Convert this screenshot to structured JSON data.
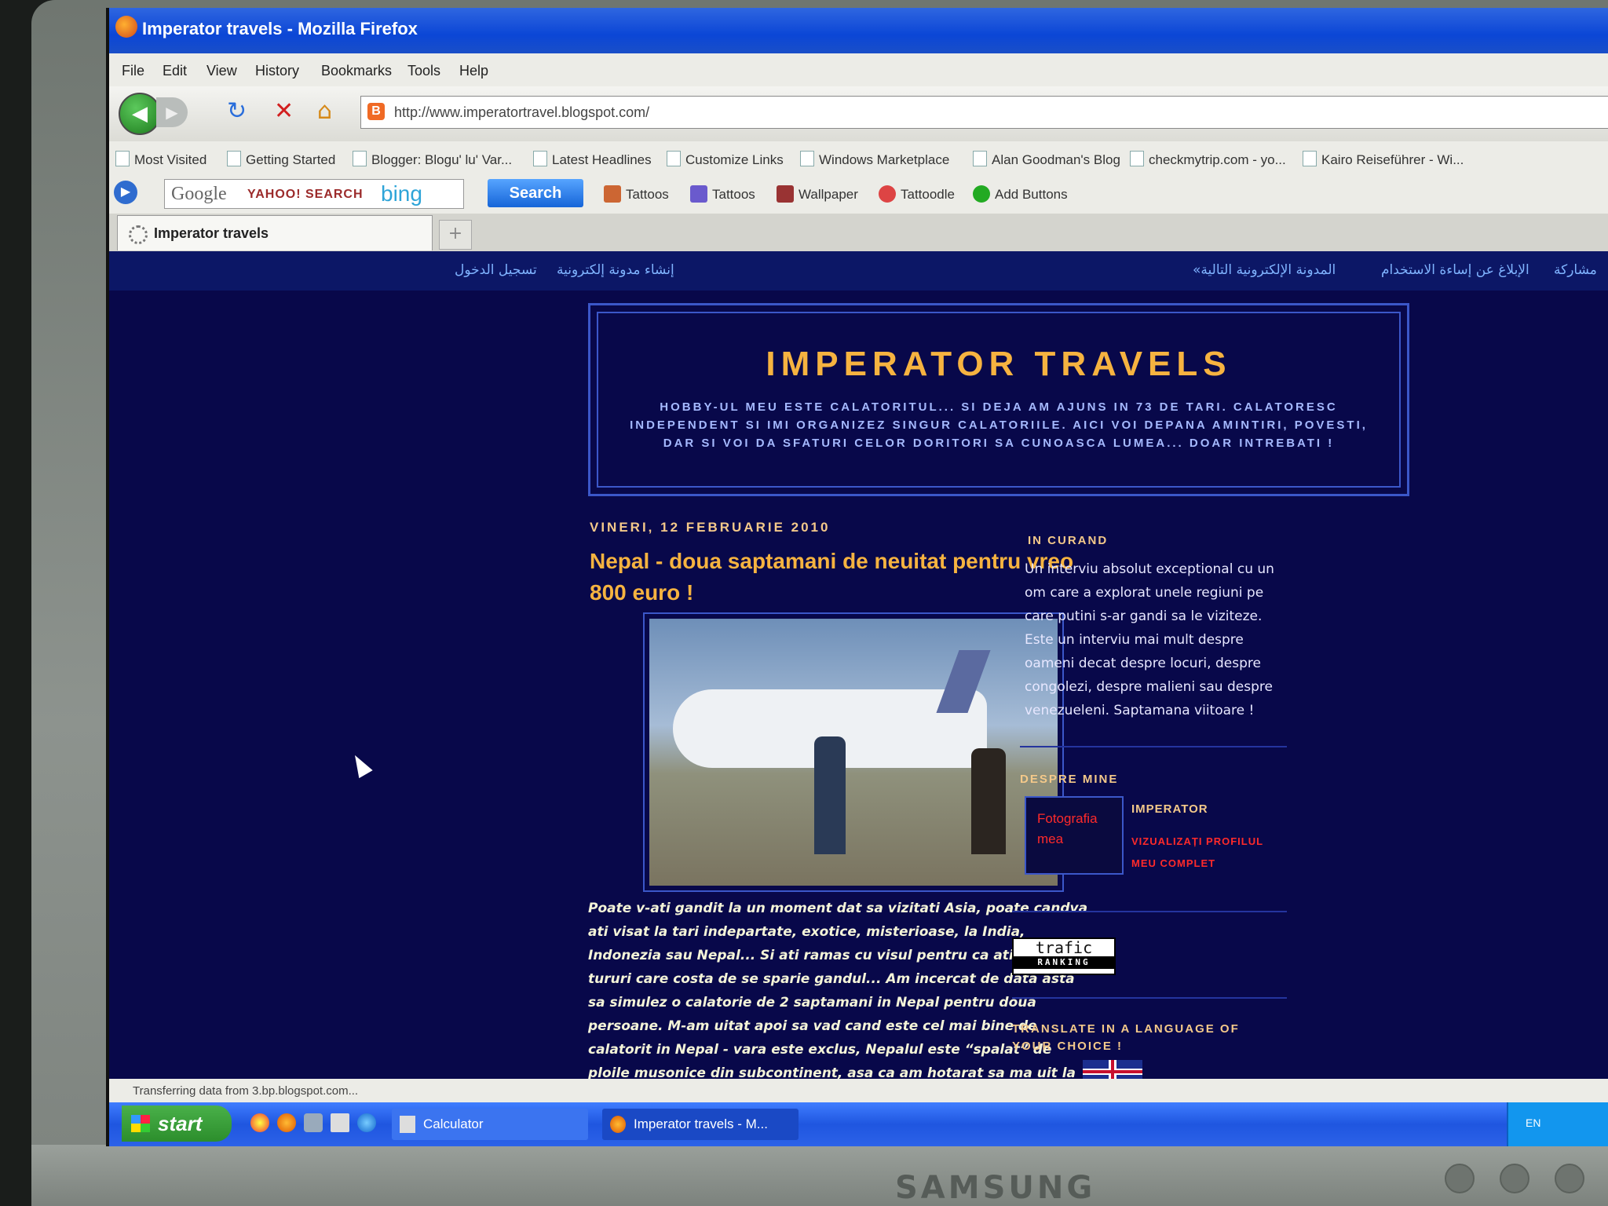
{
  "window": {
    "title": "Imperator travels - Mozilla Firefox"
  },
  "menu": [
    "File",
    "Edit",
    "View",
    "History",
    "Bookmarks",
    "Tools",
    "Help"
  ],
  "address": {
    "url": "http://www.imperatortravel.blogspot.com/"
  },
  "bookmarks": [
    "Most Visited",
    "Getting Started",
    "Blogger: Blogu' lu' Var...",
    "Latest Headlines",
    "Customize Links",
    "Windows Marketplace",
    "Alan Goodman's Blog",
    "checkmytrip.com - yo...",
    "Kairo Reiseführer - Wi..."
  ],
  "search_toolbar": {
    "google": "Google",
    "yahoo": "YAHOO! SEARCH",
    "bing": "bing",
    "search_button": "Search",
    "buttons": [
      "Tattoos",
      "Tattoos",
      "Wallpaper",
      "Tattoodle",
      "Add Buttons"
    ]
  },
  "tab": {
    "label": "Imperator travels"
  },
  "blogger_bar": {
    "left_links": [
      "إنشاء مدونة إلكترونية",
      "تسجيل الدخول"
    ],
    "right_links": [
      "المدونة الإلكترونية التالية»",
      "الإبلاغ عن إساءة الاستخدام",
      "مشاركة"
    ]
  },
  "blog": {
    "title": "IMPERATOR TRAVELS",
    "description": "HOBBY-UL MEU ESTE CALATORITUL... SI DEJA AM AJUNS IN 73 DE TARI. CALATORESC INDEPENDENT SI IMI ORGANIZEZ SINGUR CALATORIILE. AICI VOI DEPANA AMINTIRI, POVESTI, DAR SI VOI DA SFATURI CELOR DORITORI SA CUNOASCA LUMEA... DOAR INTREBATI !"
  },
  "post": {
    "date": "VINERI, 12 FEBRUARIE 2010",
    "title": "Nepal - doua saptamani de neuitat pentru vreo 800 euro !",
    "text": "Poate v-ati gandit la un moment dat sa vizitati Asia, poate candva ati visat la tari indepartate, exotice, misterioase, la India, Indonezia sau Nepal... Si ati ramas cu visul pentru ca ati gasit tururi care costa de se sparie gandul... Am incercat de data asta sa simulez o calatorie de 2 saptamani in Nepal pentru doua persoane. M-am uitat apoi sa vad cand este cel mai bine de calatorit in Nepal - vara este exclus, Nepalul este “spalat” de ploile musonice din subcontinent, asa ca am hotarat sa ma uit la ultimele doua saptamani din octombrie...."
  },
  "sidebar": {
    "soon_heading": "IN CURAND",
    "soon_text": "Un interviu absolut exceptional cu un om care a explorat unele regiuni pe care putini s-ar gandi sa le viziteze. Este un interviu mai mult despre oameni decat despre locuri, despre congolezi, despre malieni sau despre venezueleni. Saptamana viitoare !",
    "about_heading": "DESPRE MINE",
    "photo_alt": "Fotografia mea",
    "profile_name": "IMPERATOR",
    "profile_link": "VIZUALIZAȚI PROFILUL MEU COMPLET",
    "trafic_top": "trafic",
    "trafic_bottom": "RANKING",
    "translate_heading": "TRANSLATE IN A LANGUAGE OF YOUR CHOICE !"
  },
  "status": {
    "text": "Transferring data from 3.bp.blogspot.com..."
  },
  "taskbar": {
    "start": "start",
    "tasks": [
      "Calculator",
      "Imperator travels - M..."
    ],
    "tray": "EN"
  },
  "monitor": {
    "brand": "SAMSUNG"
  }
}
